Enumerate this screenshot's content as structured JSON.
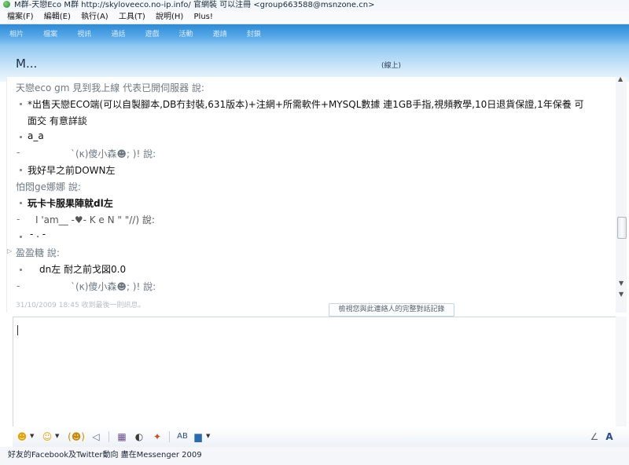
{
  "window": {
    "title": "M群-天戀Eco M群 http://skyloveeco.no-ip.info/ 官網裝 可以注冊 <group663588@msnzone.cn>"
  },
  "menu": {
    "items": [
      "檔案(F)",
      "編輯(E)",
      "執行(A)",
      "工具(T)",
      "說明(H)",
      "Plus!"
    ]
  },
  "toolbar": {
    "items": [
      "相片",
      "檔案",
      "視訊",
      "通話",
      "遊戲",
      "活動",
      "邀請",
      "封鎖"
    ]
  },
  "contact": {
    "name": "M...",
    "status": "(線上)"
  },
  "conversation": {
    "messages": [
      {
        "sender": "天戀eco gm 見到我上線 代表已開伺服器 說:"
      },
      {
        "line1": "*出售天戀ECO端(可以自製腳本,DB冇封裝,631版本)+注網+所需軟件+MYSQL數據 連1GB手指,視頻教學,10日退貨保證,1年保養 可",
        "line2": "面交 有意詳談"
      },
      {
        "text": "a_a"
      },
      {
        "sender": "`(κ)傻小森☻; )! 說:"
      },
      {
        "text": "我好早之前DOWN左"
      },
      {
        "sender": "怕悶ge娜娜 說:"
      },
      {
        "text": "玩卡卡服果陣就dl左"
      },
      {
        "sender": "I 'am__ -♥-  K e N  \"  \"//) 說:"
      },
      {
        "text": "- . -"
      },
      {
        "sender": "盈盈糖 說:"
      },
      {
        "text": "dn左   耐之前戈図0.0"
      },
      {
        "sender": "`(κ)傻小森☻; )! 說:"
      }
    ],
    "timestamp": "31/10/2009 18:45 收到最後一則訊息。",
    "history_button": "檢視您與此連絡人的完整對話記錄"
  },
  "status_bar": {
    "text": "好友的Facebook及Twitter動向  盡在Messenger 2009"
  },
  "colors": {
    "toolbar_blue": "#2c8ad6",
    "banner_light": "#c9e4f8"
  }
}
